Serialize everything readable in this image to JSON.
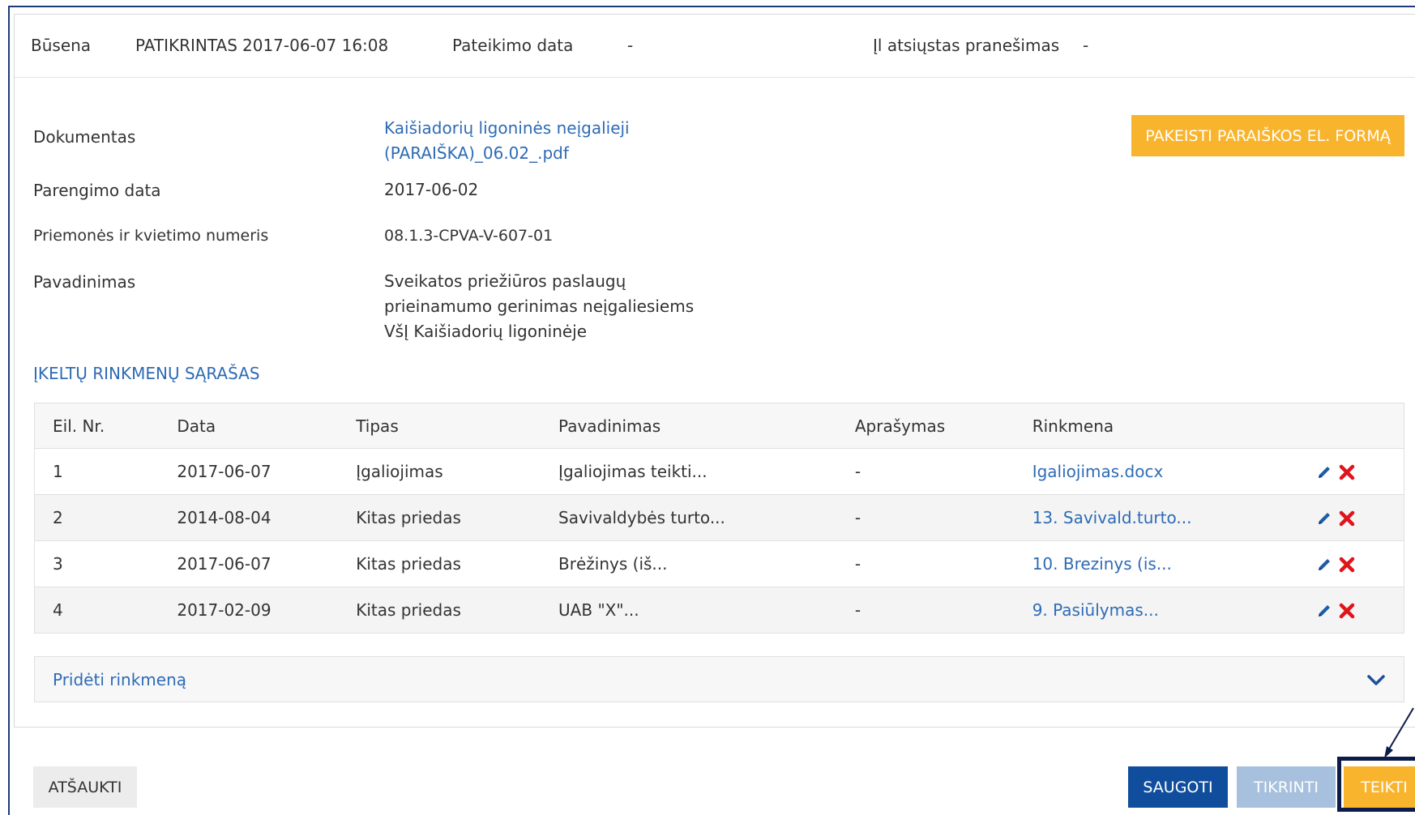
{
  "status": {
    "state_label": "Būsena",
    "state_value": "PATIKRINTAS",
    "state_time": "2017-06-07 16:08",
    "submit_date_label": "Pateikimo data",
    "submit_date_value": "-",
    "notification_label": "Įl atsiųstas pranešimas",
    "notification_value": "-"
  },
  "document": {
    "label": "Dokumentas",
    "link_line1": "Kaišiadorių ligoninės neįgalieji",
    "link_line2": "(PARAIŠKA)_06.02_.pdf",
    "change_button": "PAKEISTI PARAIŠKOS EL. FORMĄ"
  },
  "prep_date": {
    "label": "Parengimo data",
    "value": "2017-06-02"
  },
  "call_number": {
    "label": "Priemonės ir kvietimo numeris",
    "value": "08.1.3-CPVA-V-607-01"
  },
  "name": {
    "label": "Pavadinimas",
    "line1": "Sveikatos priežiūros paslaugų",
    "line2": "prieinamumo gerinimas neįgaliesiems",
    "line3": "VšĮ Kaišiadorių ligoninėje"
  },
  "files_section_title": "ĮKELTŲ RINKMENŲ SĄRAŠAS",
  "files_table": {
    "headers": [
      "Eil. Nr.",
      "Data",
      "Tipas",
      "Pavadinimas",
      "Aprašymas",
      "Rinkmena"
    ],
    "rows": [
      [
        "1",
        "2017-06-07",
        "Įgaliojimas",
        "Įgaliojimas teikti...",
        "-",
        "Igaliojimas.docx"
      ],
      [
        "2",
        "2014-08-04",
        "Kitas priedas",
        "Savivaldybės turto...",
        "-",
        "13. Savivald.turto..."
      ],
      [
        "3",
        "2017-06-07",
        "Kitas priedas",
        "Brėžinys (iš...",
        "-",
        "10. Brezinys (is..."
      ],
      [
        "4",
        "2017-02-09",
        "Kitas priedas",
        "UAB \"X\"...",
        "-",
        "9. Pasiūlymas..."
      ]
    ]
  },
  "add_file_label": "Pridėti rinkmeną",
  "buttons": {
    "cancel": "ATŠAUKTI",
    "save": "SAUGOTI",
    "check": "TIKRINTI",
    "submit": "TEIKTI"
  },
  "colors": {
    "link": "#2e6bb5",
    "accent_orange": "#f9b42d",
    "save_blue": "#104e9d",
    "check_disabled": "#a7c0dd",
    "delete_red": "#e0141b",
    "highlight_navy": "#0d1b48"
  },
  "icons": [
    "pencil-icon",
    "delete-x-icon",
    "chevron-down-icon"
  ]
}
